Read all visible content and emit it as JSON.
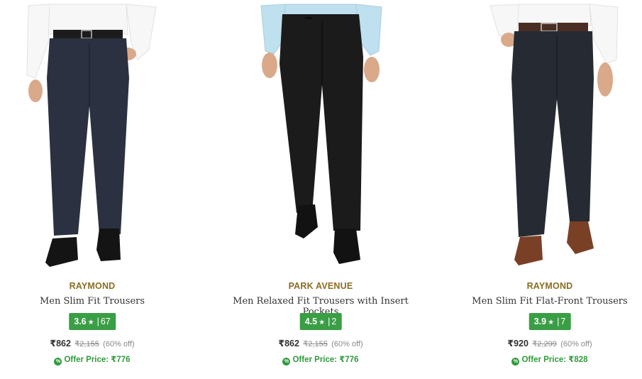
{
  "products": [
    {
      "brand": "RAYMOND",
      "title": "Men Slim Fit Trousers",
      "rating": "3.6",
      "rating_count": "67",
      "price": "₹862",
      "mrp": "₹2,155",
      "discount": "(60% off)",
      "offer": "Offer Price: ₹776",
      "colors": {
        "shirt": "#f7f7f7",
        "trouser": "#2b3140",
        "belt": "#1c1c1c",
        "shoe": "#141414"
      }
    },
    {
      "brand": "PARK AVENUE",
      "title": "Men Relaxed Fit Trousers with Insert Pockets",
      "rating": "4.5",
      "rating_count": "2",
      "price": "₹862",
      "mrp": "₹2,155",
      "discount": "(60% off)",
      "offer": "Offer Price: ₹776",
      "colors": {
        "shirt": "#bfe0ee",
        "trouser": "#1b1b1b",
        "belt": "#1b1b1b",
        "shoe": "#121212"
      }
    },
    {
      "brand": "RAYMOND",
      "title": "Men Slim Fit Flat-Front Trousers",
      "rating": "3.9",
      "rating_count": "7",
      "price": "₹920",
      "mrp": "₹2,299",
      "discount": "(60% off)",
      "offer": "Offer Price: ₹828",
      "colors": {
        "shirt": "#f7f7f7",
        "trouser": "#262b33",
        "belt": "#4a2e24",
        "shoe": "#7a4026"
      }
    }
  ],
  "icons": {
    "star": "star-icon",
    "offer": "offer-tag-icon"
  },
  "accent": {
    "brand": "#8a6d22",
    "rating_bg": "#3a9e44",
    "offer": "#2e9b3b"
  }
}
